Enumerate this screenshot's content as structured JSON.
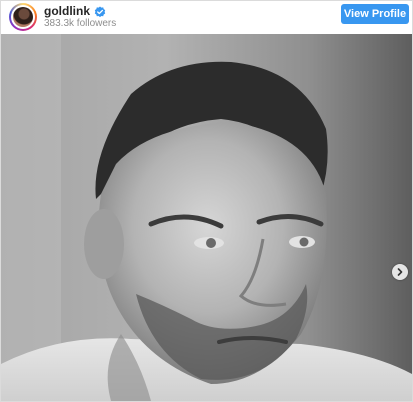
{
  "profile": {
    "username": "goldlink",
    "followers": "383.3k followers",
    "verified": true
  },
  "header": {
    "view_profile_label": "View Profile"
  },
  "post": {
    "photo_subject": "black-and-white portrait of a man with short hair and a beard",
    "has_next": true
  },
  "colors": {
    "button": "#3897f0",
    "verified_badge": "#3897f0",
    "border": "#dbdbdb"
  },
  "icons": [
    "verified-badge-icon",
    "chevron-right-icon"
  ]
}
